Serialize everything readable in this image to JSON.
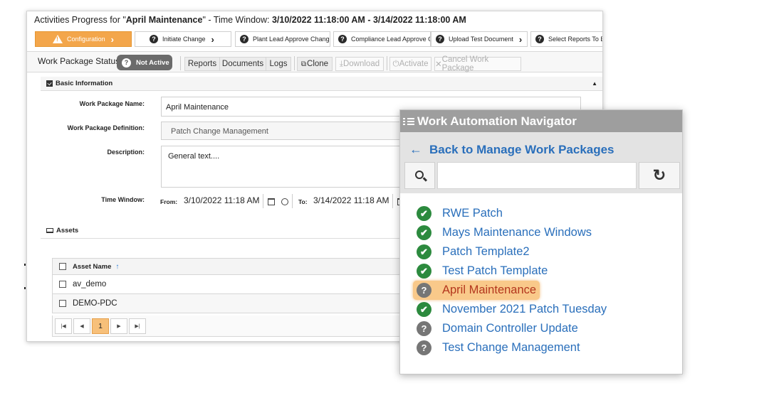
{
  "header": {
    "prefix": "Activities Progress for \"",
    "package_name": "April Maintenance",
    "mid": "\"  -  Time Window: ",
    "window": "3/10/2022 11:18:00 AM - 3/14/2022 11:18:00 AM"
  },
  "steps": [
    {
      "label": "Configuration",
      "state": "active"
    },
    {
      "label": "Initiate Change",
      "state": "pending"
    },
    {
      "label": "Plant Lead Approve Change",
      "state": "pending"
    },
    {
      "label": "Compliance Lead Approve Ch",
      "state": "pending"
    },
    {
      "label": "Upload Test Document",
      "state": "pending"
    },
    {
      "label": "Select Reports To Ex",
      "state": "pending"
    }
  ],
  "status": {
    "label": "Work Package Status:",
    "badge": "Not Active"
  },
  "toolbar": {
    "reports": "Reports",
    "documents": "Documents",
    "logs": "Logs",
    "clone": "Clone",
    "download": "Download",
    "activate": "Activate",
    "cancel": "Cancel Work Package"
  },
  "basic_info": {
    "section_title": "Basic Information",
    "name_label": "Work Package Name:",
    "name_value": "April Maintenance",
    "definition_label": "Work Package Definition:",
    "definition_value": "Patch Change Management",
    "description_label": "Description:",
    "description_value": "General text....",
    "time_window_label": "Time Window:",
    "from_label": "From:",
    "from_value": "3/10/2022 11:18 AM",
    "to_label": "To:",
    "to_value": "3/14/2022 11:18 AM"
  },
  "assets": {
    "section_title": "Assets",
    "column_name": "Asset Name",
    "sort_arrow": "↑",
    "rows": [
      "av_demo",
      "DEMO-PDC"
    ],
    "pager": {
      "current_page": "1"
    }
  },
  "navigator": {
    "title": "Work Automation Navigator",
    "back_label": "Back to Manage Work Packages",
    "search_value": "",
    "items": [
      {
        "label": "RWE Patch",
        "status": "complete"
      },
      {
        "label": "Mays Maintenance Windows",
        "status": "complete"
      },
      {
        "label": "Patch Template2",
        "status": "complete"
      },
      {
        "label": "Test Patch Template",
        "status": "complete"
      },
      {
        "label": "April Maintenance",
        "status": "unknown",
        "selected": true
      },
      {
        "label": "November 2021 Patch Tuesday",
        "status": "complete"
      },
      {
        "label": "Domain Controller Update",
        "status": "unknown"
      },
      {
        "label": "Test Change Management",
        "status": "unknown"
      }
    ]
  },
  "colors": {
    "accent_orange": "#f3a64b",
    "link_blue": "#2a6fbb",
    "success_green": "#2c8a3e",
    "highlight": "#f9c98a"
  }
}
